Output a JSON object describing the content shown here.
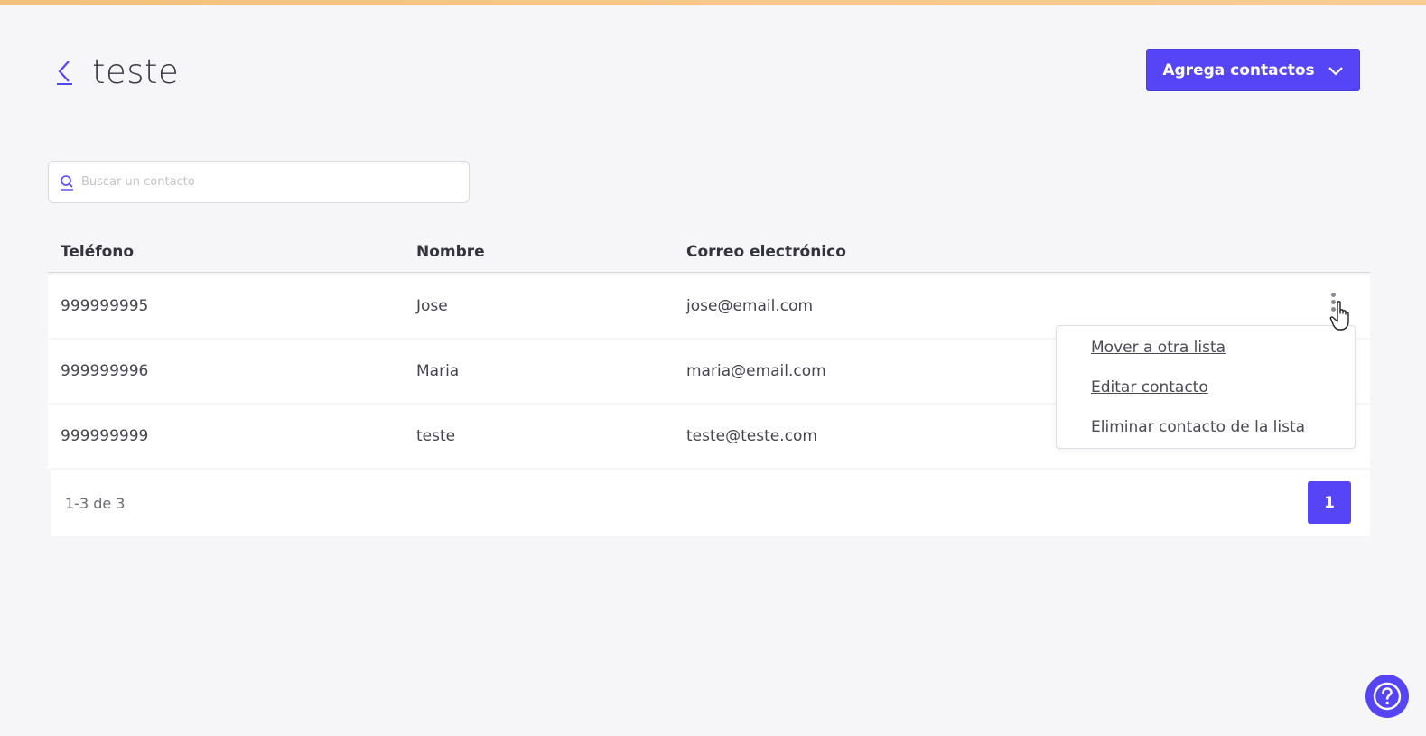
{
  "header": {
    "title": "teste",
    "add_button_label": "Agrega contactos"
  },
  "search": {
    "placeholder": "Buscar un contacto",
    "value": ""
  },
  "table": {
    "columns": {
      "phone": "Teléfono",
      "name": "Nombre",
      "email": "Correo electrónico"
    },
    "rows": [
      {
        "phone": "999999995",
        "name": "Jose",
        "email": "jose@email.com"
      },
      {
        "phone": "999999996",
        "name": "Maria",
        "email": "maria@email.com"
      },
      {
        "phone": "999999999",
        "name": "teste",
        "email": "teste@teste.com"
      }
    ]
  },
  "pagination": {
    "range_text": "1-3 de 3",
    "current_page": "1"
  },
  "row_menu": {
    "items": [
      "Mover a otra lista",
      "Editar contacto",
      "Eliminar contacto de la lista"
    ]
  },
  "colors": {
    "accent": "#5645f6",
    "background": "#f6f6f8",
    "top_strip": "#f3c27c"
  },
  "icons": {
    "back": "chevron-left-icon",
    "dropdown": "chevron-down-icon",
    "search": "search-icon",
    "row_actions": "kebab-menu-icon",
    "help": "question-mark-icon"
  }
}
